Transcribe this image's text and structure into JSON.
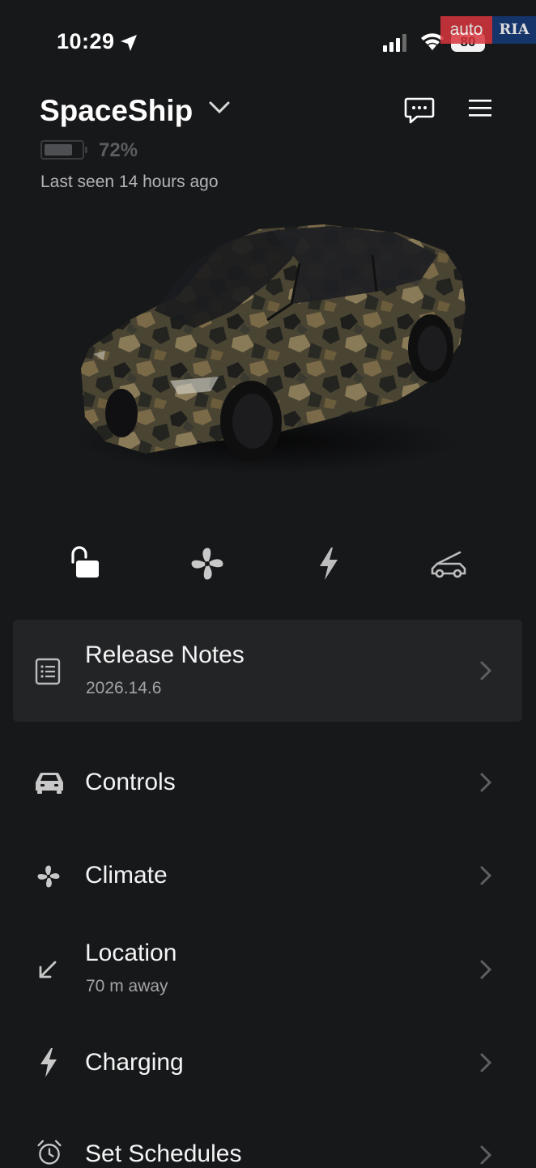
{
  "status_bar": {
    "time": "10:29",
    "battery": "80",
    "watermark": {
      "left": "auto",
      "right": "RIA"
    }
  },
  "header": {
    "car_name": "SpaceShip",
    "battery_percent": "72%",
    "last_seen": "Last seen 14 hours ago"
  },
  "quick_actions": [
    {
      "name": "unlock",
      "icon": "unlocked-padlock-icon"
    },
    {
      "name": "climate",
      "icon": "fan-icon"
    },
    {
      "name": "charge",
      "icon": "lightning-icon"
    },
    {
      "name": "frunk",
      "icon": "open-frunk-car-icon"
    }
  ],
  "menu": {
    "release_notes": {
      "title": "Release Notes",
      "subtitle": "2026.14.6"
    },
    "controls": {
      "title": "Controls"
    },
    "climate": {
      "title": "Climate"
    },
    "location": {
      "title": "Location",
      "subtitle": "70 m away"
    },
    "charging": {
      "title": "Charging"
    },
    "schedules": {
      "title": "Set Schedules"
    }
  },
  "colors": {
    "background": "#17181a",
    "card": "#232426",
    "text": "#f4f4f4",
    "muted": "#a4a4a6"
  }
}
